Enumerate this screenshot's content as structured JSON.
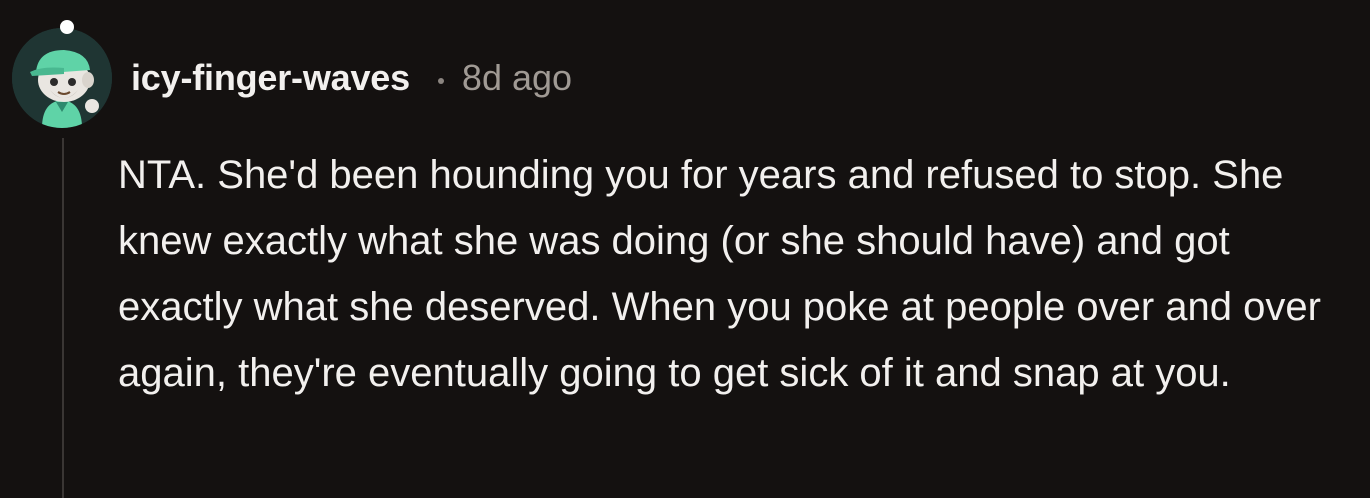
{
  "comment": {
    "username": "icy-finger-waves",
    "separator": "•",
    "timestamp": "8d ago",
    "body": "NTA. She'd been hounding you for years and refused to stop. She knew exactly what she was doing (or she should have) and got exactly what she deserved. When you poke at people over and over again, they're eventually going to get sick of it and snap at you.",
    "avatar_icon": "snoo-avatar-icon",
    "status": "online"
  },
  "colors": {
    "background": "#141110",
    "text": "#f2f0ee",
    "muted": "#a09a94",
    "avatar_bg": "#1f3533",
    "avatar_accent": "#5fd3a7",
    "thread_line": "#3a3634"
  }
}
